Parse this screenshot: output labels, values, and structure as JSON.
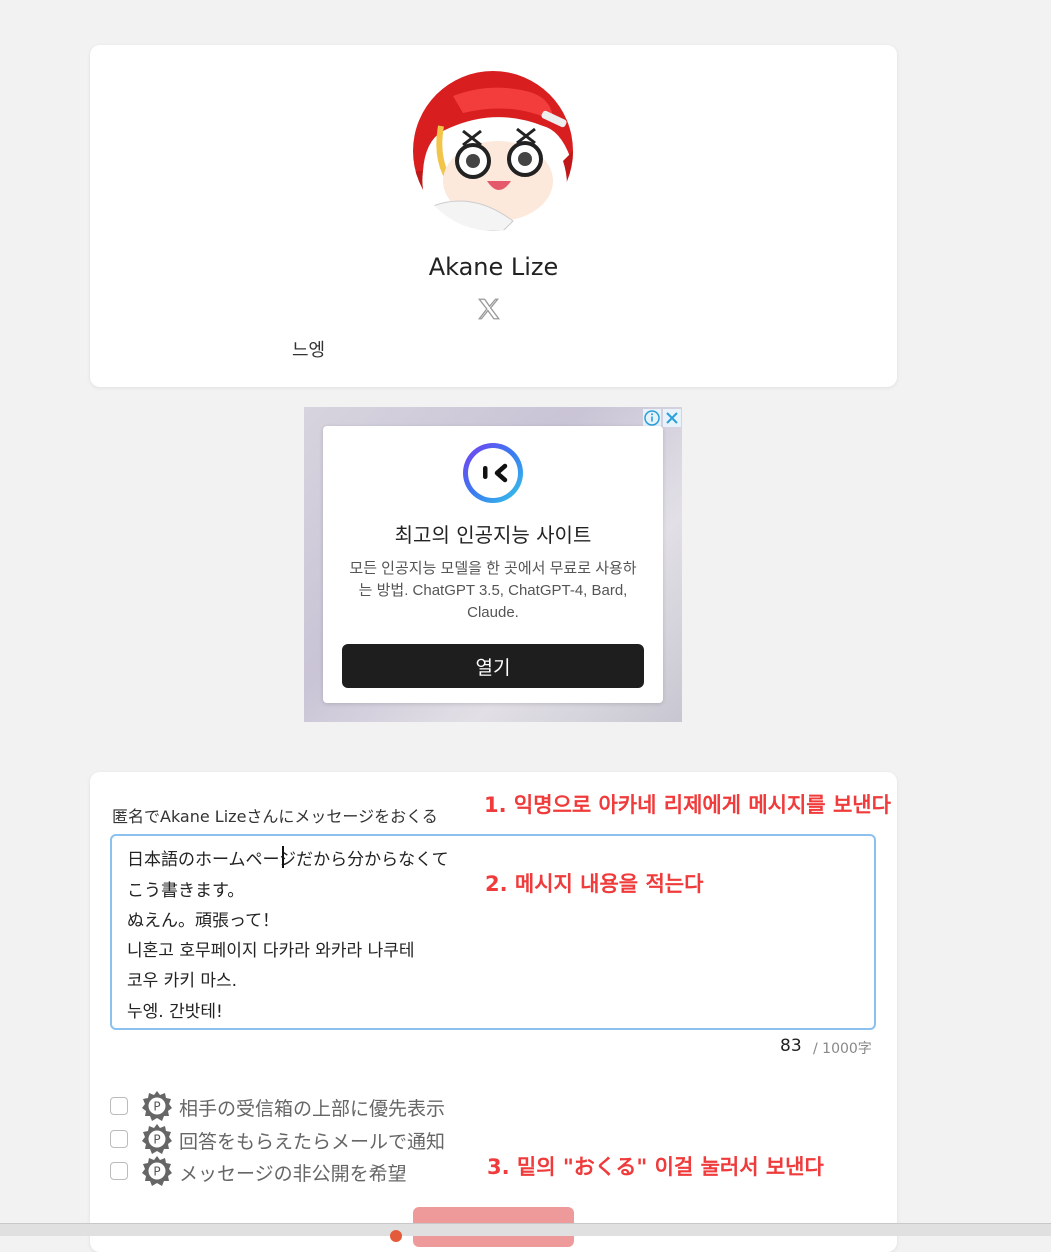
{
  "profile": {
    "name": "Akane Lize",
    "bio": "느엥",
    "social_icon": "x-logo-icon",
    "avatar": "anime-character-avatar"
  },
  "ad": {
    "title": "최고의 인공지능 사이트",
    "description": "모든 인공지능 모델을 한 곳에서 무료로 사용하는 방법. ChatGPT 3.5, ChatGPT-4, Bard, Claude.",
    "button_label": "열기",
    "info_icon": "info-icon",
    "close_icon": "close-icon"
  },
  "message": {
    "label": "匿名でAkane Lizeさんにメッセージをおくる",
    "lines": [
      "日本語のホームページだから分からなくて",
      "こう書きます。",
      "ぬえん。頑張って！",
      "니혼고 호무페이지 다카라 와카라 나쿠테",
      "코우 카키 마스.",
      "누엥. 간밧테!"
    ],
    "count": "83",
    "max": "/ 1000字"
  },
  "options": [
    {
      "label": "相手の受信箱の上部に優先表示",
      "badge": "P",
      "checked": false
    },
    {
      "label": "回答をもらえたらメールで通知",
      "badge": "P",
      "checked": false
    },
    {
      "label": "メッセージの非公開を希望",
      "badge": "P",
      "checked": false
    }
  ],
  "annotations": {
    "step1": "1. 익명으로 아카네 리제에게 메시지를 보낸다",
    "step2": "2. 메시지 내용을 적는다",
    "step3": "3. 밑의 \"おくる\" 이걸 눌러서 보낸다"
  },
  "colors": {
    "annotation": "#ef3b3b",
    "submit": "#ef9a9a",
    "textarea_border": "#8cc1ef"
  }
}
